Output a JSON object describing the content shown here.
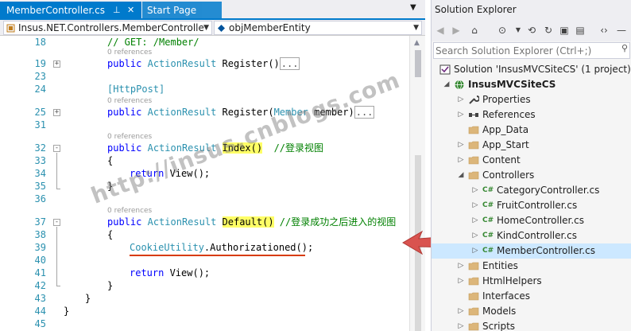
{
  "tabs": {
    "active": {
      "label": "MemberController.cs",
      "pin": "⊥",
      "close": "✕"
    },
    "inactive": {
      "label": "Start Page"
    }
  },
  "navbar": {
    "class_combo": "Insus.NET.Controllers.MemberControlle",
    "member_combo": "objMemberEntity"
  },
  "code_lines": [
    {
      "num": "18",
      "text": "// GET: /Member/",
      "kind": "comment-top"
    },
    {
      "num": "19",
      "lens": "0 references",
      "fold": "+"
    },
    {
      "num": "23"
    },
    {
      "num": "24"
    },
    {
      "num": "25",
      "lens": "0 references",
      "fold": "+"
    },
    {
      "num": "31"
    },
    {
      "num": "32",
      "lens": "0 references",
      "fold": "-"
    },
    {
      "num": "33"
    },
    {
      "num": "34"
    },
    {
      "num": "35"
    },
    {
      "num": "36"
    },
    {
      "num": "37",
      "lens": "0 references",
      "fold": "-"
    },
    {
      "num": "38"
    },
    {
      "num": "39"
    },
    {
      "num": "40"
    },
    {
      "num": "41"
    },
    {
      "num": "42"
    },
    {
      "num": "43"
    },
    {
      "num": "44"
    },
    {
      "num": "45"
    }
  ],
  "code": {
    "l18": "// GET: /Member/",
    "lens": "0 references",
    "public": "public",
    "action_result": "ActionResult",
    "register": "Register()",
    "ellipsis": "...",
    "http_post": "[HttpPost]",
    "register2_a": "Register(",
    "member_type": "Member",
    "register2_b": " member)",
    "index": "Index()",
    "index_comment": "//登录视图",
    "brace_open": "{",
    "brace_close": "}",
    "return_view": "return View();",
    "default": "Default()",
    "default_comment": "//登录成功之后进入的视图",
    "cookie_utility": "CookieUtility",
    "authorizationed": ".Authorizationed();"
  },
  "watermark": "http://insus.cnblogs.com",
  "solution_explorer": {
    "title": "Solution Explorer",
    "search_placeholder": "Search Solution Explorer (Ctrl+;)",
    "tree": [
      {
        "label": "Solution 'InsusMVCSiteCS' (1 project)",
        "level": 0,
        "icon": "solution-icon",
        "expander": ""
      },
      {
        "label": "InsusMVCSiteCS",
        "level": 1,
        "icon": "web-project-icon",
        "expander": "◢",
        "bold": true
      },
      {
        "label": "Properties",
        "level": 2,
        "icon": "wrench-icon",
        "expander": "▷"
      },
      {
        "label": "References",
        "level": 2,
        "icon": "references-icon",
        "expander": "▷"
      },
      {
        "label": "App_Data",
        "level": 2,
        "icon": "folder-icon",
        "expander": ""
      },
      {
        "label": "App_Start",
        "level": 2,
        "icon": "folder-icon",
        "expander": "▷"
      },
      {
        "label": "Content",
        "level": 2,
        "icon": "folder-icon",
        "expander": "▷"
      },
      {
        "label": "Controllers",
        "level": 2,
        "icon": "folder-open-icon",
        "expander": "◢"
      },
      {
        "label": "CategoryController.cs",
        "level": 3,
        "icon": "csharp-file-icon",
        "expander": "▷"
      },
      {
        "label": "FruitController.cs",
        "level": 3,
        "icon": "csharp-file-icon",
        "expander": "▷"
      },
      {
        "label": "HomeController.cs",
        "level": 3,
        "icon": "csharp-file-icon",
        "expander": "▷"
      },
      {
        "label": "KindController.cs",
        "level": 3,
        "icon": "csharp-file-icon",
        "expander": "▷"
      },
      {
        "label": "MemberController.cs",
        "level": 3,
        "icon": "csharp-file-icon",
        "expander": "▷",
        "selected": true
      },
      {
        "label": "Entities",
        "level": 2,
        "icon": "folder-icon",
        "expander": "▷"
      },
      {
        "label": "HtmlHelpers",
        "level": 2,
        "icon": "folder-icon",
        "expander": "▷"
      },
      {
        "label": "Interfaces",
        "level": 2,
        "icon": "folder-icon",
        "expander": ""
      },
      {
        "label": "Models",
        "level": 2,
        "icon": "folder-icon",
        "expander": "▷"
      },
      {
        "label": "Scripts",
        "level": 2,
        "icon": "folder-icon",
        "expander": "▷"
      }
    ]
  },
  "colors": {
    "accent": "#007acc",
    "keyword": "#0000ff",
    "type": "#2b91af",
    "comment": "#008000",
    "highlight": "#ffff66",
    "arrow": "#d9534f",
    "selection": "#cce8ff"
  }
}
